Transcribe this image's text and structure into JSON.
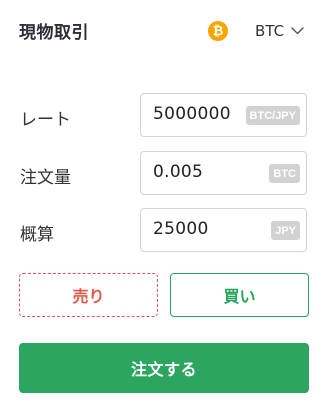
{
  "header": {
    "title": "現物取引",
    "coin_icon": "bitcoin-icon",
    "coin_icon_glyph": "₿",
    "currency": "BTC"
  },
  "form": {
    "rate": {
      "label": "レート",
      "value": "5000000",
      "unit": "BTC/JPY"
    },
    "amount": {
      "label": "注文量",
      "value": "0.005",
      "unit": "BTC"
    },
    "estimate": {
      "label": "概算",
      "value": "25000",
      "unit": "JPY"
    }
  },
  "side": {
    "sell_label": "売り",
    "buy_label": "買い"
  },
  "submit": {
    "label": "注文する"
  },
  "colors": {
    "sell": "#e2574c",
    "buy": "#2aa55d",
    "submit_bg": "#2ba560",
    "coin": "#f7a600",
    "badge": "#d2d2d2"
  }
}
